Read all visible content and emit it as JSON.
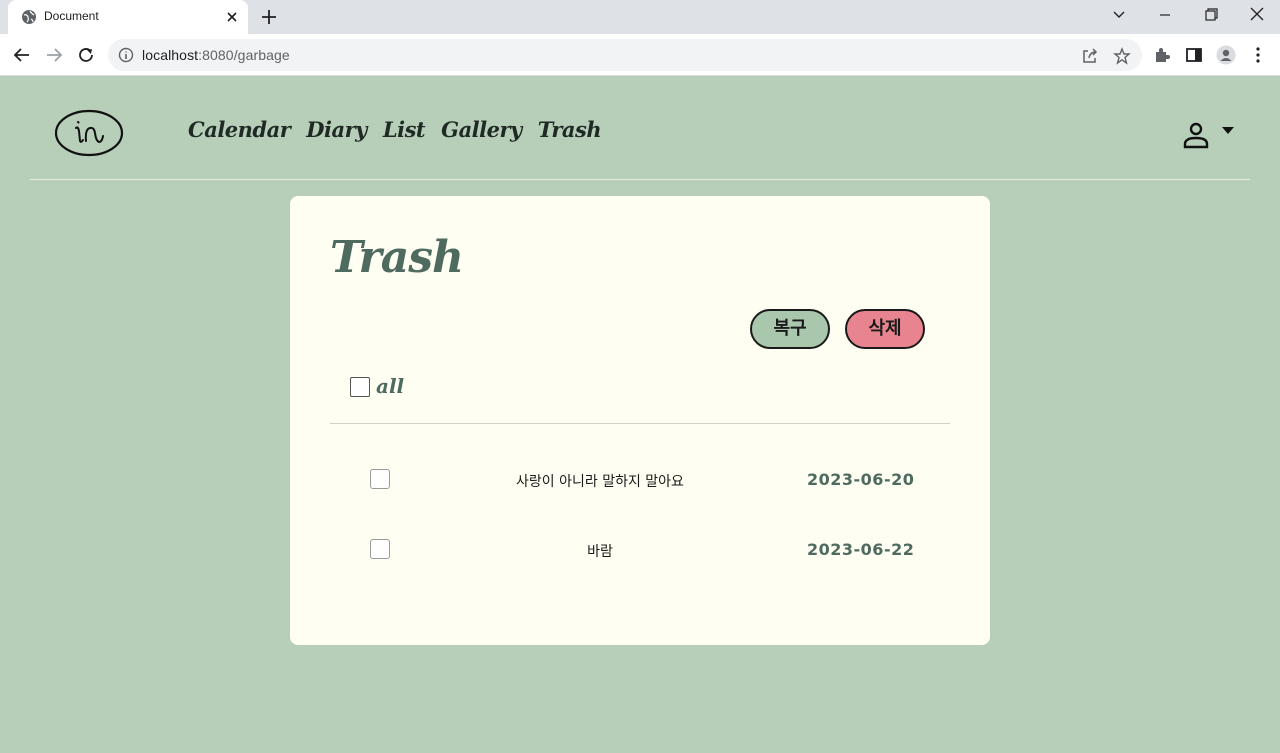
{
  "browser": {
    "tab_title": "Document",
    "url_host": "localhost",
    "url_path": ":8080/garbage"
  },
  "nav": {
    "logo_text": "in",
    "items": [
      "Calendar",
      "Diary",
      "List",
      "Gallery",
      "Trash"
    ]
  },
  "main": {
    "heading": "Trash",
    "restore_label": "복구",
    "delete_label": "삭제",
    "select_all_label": "all",
    "rows": [
      {
        "title": "사랑이 아니라 말하지 말아요",
        "date": "2023-06-20"
      },
      {
        "title": "바람",
        "date": "2023-06-22"
      }
    ]
  },
  "colors": {
    "page_bg": "#b7cfb9",
    "card_bg": "#fefef2",
    "accent": "#4f6a5f",
    "restore_btn": "#a9c7ad",
    "delete_btn": "#e8848f"
  }
}
